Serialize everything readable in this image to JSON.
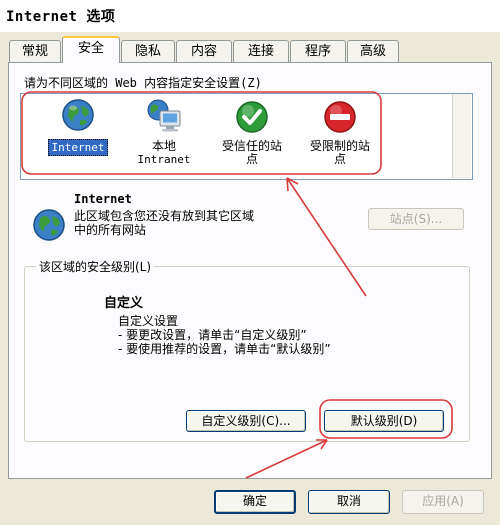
{
  "window": {
    "title": "Internet 选项"
  },
  "tabs": [
    {
      "label": "常规"
    },
    {
      "label": "安全",
      "active": true
    },
    {
      "label": "隐私"
    },
    {
      "label": "内容"
    },
    {
      "label": "连接"
    },
    {
      "label": "程序"
    },
    {
      "label": "高级"
    }
  ],
  "security": {
    "zone_prompt": "请为不同区域的 Web 内容指定安全设置(Z)",
    "zones": [
      {
        "label": "Internet",
        "icon": "globe-icon",
        "selected": true
      },
      {
        "label_line1": "本地",
        "label_line2": "Intranet",
        "icon": "computer-globe-icon"
      },
      {
        "label_line1": "受信任的站",
        "label_line2": "点",
        "icon": "green-check-icon"
      },
      {
        "label_line1": "受限制的站",
        "label_line2": "点",
        "icon": "red-no-entry-icon"
      }
    ],
    "selected_zone": {
      "name": "Internet",
      "description_line1": "此区域包含您还没有放到其它区域",
      "description_line2": "中的所有网站"
    },
    "sites_button": "站点(S)...",
    "level_group_title": "该区域的安全级别(L)",
    "level": {
      "title": "自定义",
      "line1": "自定义设置",
      "line2": "- 要更改设置，请单击“自定义级别”",
      "line3": "- 要使用推荐的设置，请单击“默认级别”"
    },
    "custom_level_button": "自定义级别(C)...",
    "default_level_button": "默认级别(D)"
  },
  "footer": {
    "ok_button": "确定",
    "cancel_button": "取消",
    "apply_button": "应用(A)"
  },
  "colors": {
    "annotation": "#d83a3a",
    "selection": "#316ac5",
    "tab_highlight": "#ffc83c",
    "dialog_bg": "#ece9d8"
  }
}
